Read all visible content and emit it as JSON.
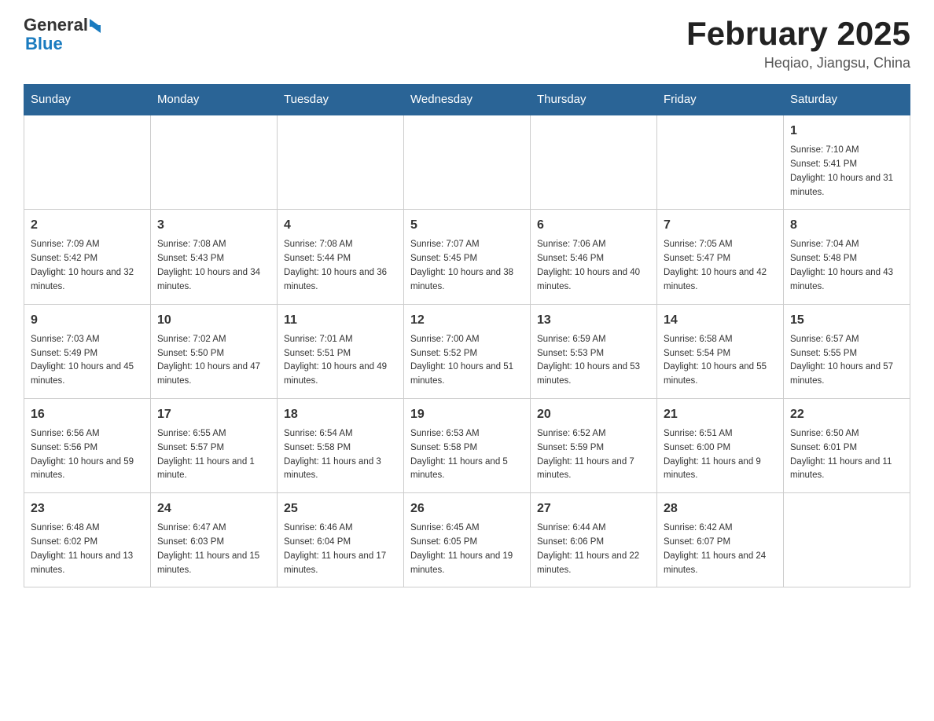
{
  "header": {
    "logo": {
      "text1": "General",
      "text2": "Blue"
    },
    "title": "February 2025",
    "subtitle": "Heqiao, Jiangsu, China"
  },
  "weekdays": [
    "Sunday",
    "Monday",
    "Tuesday",
    "Wednesday",
    "Thursday",
    "Friday",
    "Saturday"
  ],
  "weeks": [
    [
      {
        "day": null
      },
      {
        "day": null
      },
      {
        "day": null
      },
      {
        "day": null
      },
      {
        "day": null
      },
      {
        "day": null
      },
      {
        "day": "1",
        "sunrise": "7:10 AM",
        "sunset": "5:41 PM",
        "daylight": "10 hours and 31 minutes."
      }
    ],
    [
      {
        "day": "2",
        "sunrise": "7:09 AM",
        "sunset": "5:42 PM",
        "daylight": "10 hours and 32 minutes."
      },
      {
        "day": "3",
        "sunrise": "7:08 AM",
        "sunset": "5:43 PM",
        "daylight": "10 hours and 34 minutes."
      },
      {
        "day": "4",
        "sunrise": "7:08 AM",
        "sunset": "5:44 PM",
        "daylight": "10 hours and 36 minutes."
      },
      {
        "day": "5",
        "sunrise": "7:07 AM",
        "sunset": "5:45 PM",
        "daylight": "10 hours and 38 minutes."
      },
      {
        "day": "6",
        "sunrise": "7:06 AM",
        "sunset": "5:46 PM",
        "daylight": "10 hours and 40 minutes."
      },
      {
        "day": "7",
        "sunrise": "7:05 AM",
        "sunset": "5:47 PM",
        "daylight": "10 hours and 42 minutes."
      },
      {
        "day": "8",
        "sunrise": "7:04 AM",
        "sunset": "5:48 PM",
        "daylight": "10 hours and 43 minutes."
      }
    ],
    [
      {
        "day": "9",
        "sunrise": "7:03 AM",
        "sunset": "5:49 PM",
        "daylight": "10 hours and 45 minutes."
      },
      {
        "day": "10",
        "sunrise": "7:02 AM",
        "sunset": "5:50 PM",
        "daylight": "10 hours and 47 minutes."
      },
      {
        "day": "11",
        "sunrise": "7:01 AM",
        "sunset": "5:51 PM",
        "daylight": "10 hours and 49 minutes."
      },
      {
        "day": "12",
        "sunrise": "7:00 AM",
        "sunset": "5:52 PM",
        "daylight": "10 hours and 51 minutes."
      },
      {
        "day": "13",
        "sunrise": "6:59 AM",
        "sunset": "5:53 PM",
        "daylight": "10 hours and 53 minutes."
      },
      {
        "day": "14",
        "sunrise": "6:58 AM",
        "sunset": "5:54 PM",
        "daylight": "10 hours and 55 minutes."
      },
      {
        "day": "15",
        "sunrise": "6:57 AM",
        "sunset": "5:55 PM",
        "daylight": "10 hours and 57 minutes."
      }
    ],
    [
      {
        "day": "16",
        "sunrise": "6:56 AM",
        "sunset": "5:56 PM",
        "daylight": "10 hours and 59 minutes."
      },
      {
        "day": "17",
        "sunrise": "6:55 AM",
        "sunset": "5:57 PM",
        "daylight": "11 hours and 1 minute."
      },
      {
        "day": "18",
        "sunrise": "6:54 AM",
        "sunset": "5:58 PM",
        "daylight": "11 hours and 3 minutes."
      },
      {
        "day": "19",
        "sunrise": "6:53 AM",
        "sunset": "5:58 PM",
        "daylight": "11 hours and 5 minutes."
      },
      {
        "day": "20",
        "sunrise": "6:52 AM",
        "sunset": "5:59 PM",
        "daylight": "11 hours and 7 minutes."
      },
      {
        "day": "21",
        "sunrise": "6:51 AM",
        "sunset": "6:00 PM",
        "daylight": "11 hours and 9 minutes."
      },
      {
        "day": "22",
        "sunrise": "6:50 AM",
        "sunset": "6:01 PM",
        "daylight": "11 hours and 11 minutes."
      }
    ],
    [
      {
        "day": "23",
        "sunrise": "6:48 AM",
        "sunset": "6:02 PM",
        "daylight": "11 hours and 13 minutes."
      },
      {
        "day": "24",
        "sunrise": "6:47 AM",
        "sunset": "6:03 PM",
        "daylight": "11 hours and 15 minutes."
      },
      {
        "day": "25",
        "sunrise": "6:46 AM",
        "sunset": "6:04 PM",
        "daylight": "11 hours and 17 minutes."
      },
      {
        "day": "26",
        "sunrise": "6:45 AM",
        "sunset": "6:05 PM",
        "daylight": "11 hours and 19 minutes."
      },
      {
        "day": "27",
        "sunrise": "6:44 AM",
        "sunset": "6:06 PM",
        "daylight": "11 hours and 22 minutes."
      },
      {
        "day": "28",
        "sunrise": "6:42 AM",
        "sunset": "6:07 PM",
        "daylight": "11 hours and 24 minutes."
      },
      {
        "day": null
      }
    ]
  ]
}
